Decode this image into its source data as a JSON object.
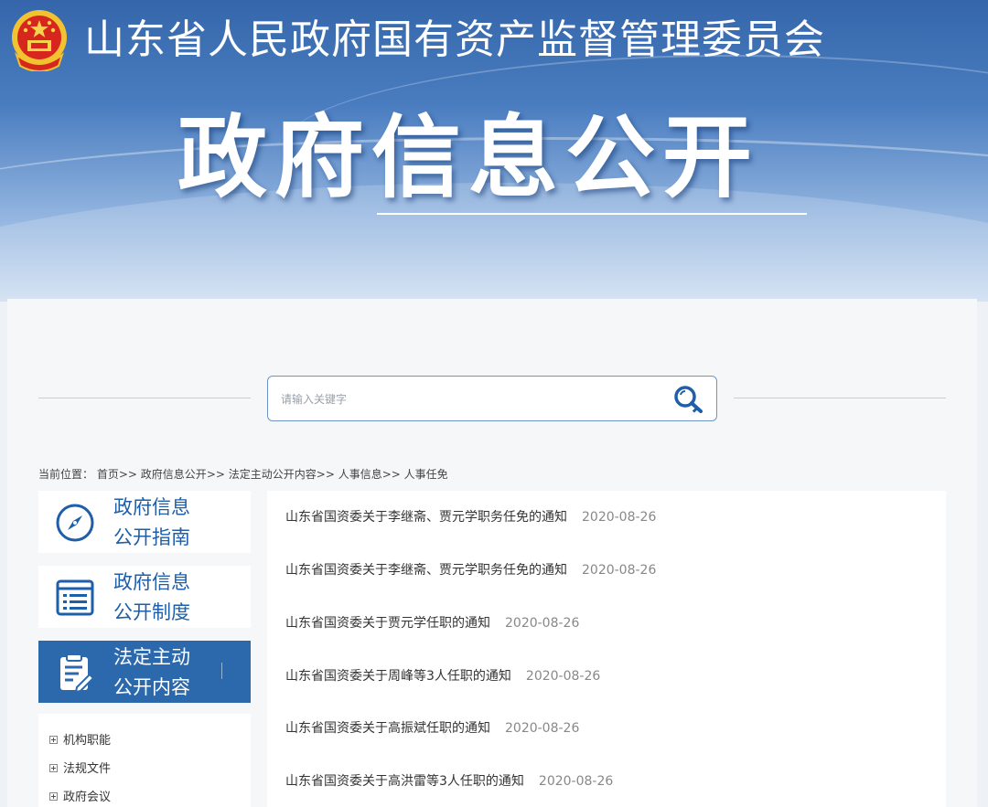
{
  "header": {
    "site_title": "山东省人民政府国有资产监督管理委员会",
    "page_title": "政府信息公开"
  },
  "search": {
    "placeholder": "请输入关键字",
    "value": ""
  },
  "breadcrumb": {
    "label": "当前位置：",
    "items": [
      "首页",
      "政府信息公开",
      "法定主动公开内容",
      "人事信息",
      "人事任免"
    ],
    "separator": ">>"
  },
  "sidebar": {
    "items": [
      {
        "label_line1": "政府信息",
        "label_line2": "公开指南",
        "icon": "compass-icon",
        "active": false
      },
      {
        "label_line1": "政府信息",
        "label_line2": "公开制度",
        "icon": "document-list-icon",
        "active": false
      },
      {
        "label_line1": "法定主动",
        "label_line2": "公开内容",
        "icon": "clipboard-edit-icon",
        "active": true
      }
    ],
    "tree": [
      "机构职能",
      "法规文件",
      "政府会议"
    ]
  },
  "articles": [
    {
      "title": "山东省国资委关于李继斋、贾元学职务任免的通知",
      "date": "2020-08-26"
    },
    {
      "title": "山东省国资委关于李继斋、贾元学职务任免的通知",
      "date": "2020-08-26"
    },
    {
      "title": "山东省国资委关于贾元学任职的通知",
      "date": "2020-08-26"
    },
    {
      "title": "山东省国资委关于周峰等3人任职的通知",
      "date": "2020-08-26"
    },
    {
      "title": "山东省国资委关于高振斌任职的通知",
      "date": "2020-08-26"
    },
    {
      "title": "山东省国资委关于高洪雷等3人任职的通知",
      "date": "2020-08-26"
    }
  ],
  "colors": {
    "brand_blue": "#2b68ac",
    "link_blue": "#1f5ea8",
    "banner_top": "#3566ab"
  }
}
